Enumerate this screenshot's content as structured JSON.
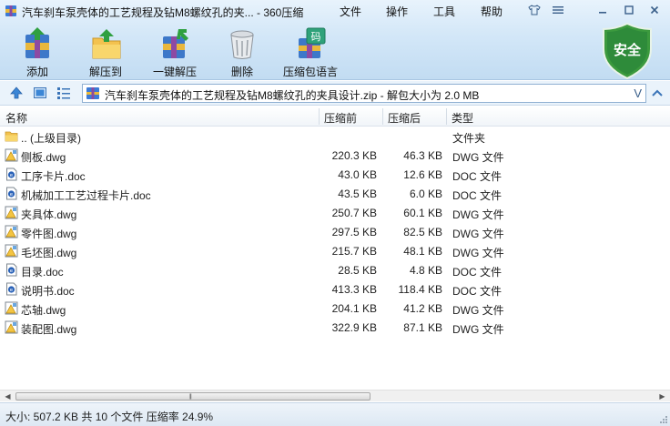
{
  "window": {
    "title": "汽车刹车泵壳体的工艺规程及钻M8螺纹孔的夹... - 360压缩",
    "menus": [
      "文件",
      "操作",
      "工具",
      "帮助"
    ]
  },
  "toolbar": {
    "add_label": "添加",
    "extract_label": "解压到",
    "one_click_label": "一键解压",
    "delete_label": "删除",
    "lang_label": "压缩包语言",
    "lang_icon_char": "码",
    "security_label": "安全"
  },
  "address": {
    "path": "汽车刹车泵壳体的工艺规程及钻M8螺纹孔的夹具设计.zip - 解包大小为 2.0 MB",
    "dropdown_char": "V"
  },
  "columns": {
    "name": "名称",
    "size": "压缩前",
    "packed": "压缩后",
    "type": "类型"
  },
  "files": [
    {
      "name": ".. (上级目录)",
      "size": "",
      "packed": "",
      "type": "文件夹",
      "kind": "folder"
    },
    {
      "name": "侧板.dwg",
      "size": "220.3 KB",
      "packed": "46.3 KB",
      "type": "DWG 文件",
      "kind": "dwg"
    },
    {
      "name": "工序卡片.doc",
      "size": "43.0 KB",
      "packed": "12.6 KB",
      "type": "DOC 文件",
      "kind": "doc"
    },
    {
      "name": "机械加工工艺过程卡片.doc",
      "size": "43.5 KB",
      "packed": "6.0 KB",
      "type": "DOC 文件",
      "kind": "doc"
    },
    {
      "name": "夹具体.dwg",
      "size": "250.7 KB",
      "packed": "60.1 KB",
      "type": "DWG 文件",
      "kind": "dwg"
    },
    {
      "name": "零件图.dwg",
      "size": "297.5 KB",
      "packed": "82.5 KB",
      "type": "DWG 文件",
      "kind": "dwg"
    },
    {
      "name": "毛坯图.dwg",
      "size": "215.7 KB",
      "packed": "48.1 KB",
      "type": "DWG 文件",
      "kind": "dwg"
    },
    {
      "name": "目录.doc",
      "size": "28.5 KB",
      "packed": "4.8 KB",
      "type": "DOC 文件",
      "kind": "doc"
    },
    {
      "name": "说明书.doc",
      "size": "413.3 KB",
      "packed": "118.4 KB",
      "type": "DOC 文件",
      "kind": "doc"
    },
    {
      "name": "芯轴.dwg",
      "size": "204.1 KB",
      "packed": "41.2 KB",
      "type": "DWG 文件",
      "kind": "dwg"
    },
    {
      "name": "装配图.dwg",
      "size": "322.9 KB",
      "packed": "87.1 KB",
      "type": "DWG 文件",
      "kind": "dwg"
    }
  ],
  "status": {
    "text": "大小: 507.2 KB 共 10 个文件 压缩率 24.9%"
  },
  "colors": {
    "accent": "#2e8b3a",
    "folder": "#f2c14e",
    "doc_blue": "#2a62b8"
  }
}
